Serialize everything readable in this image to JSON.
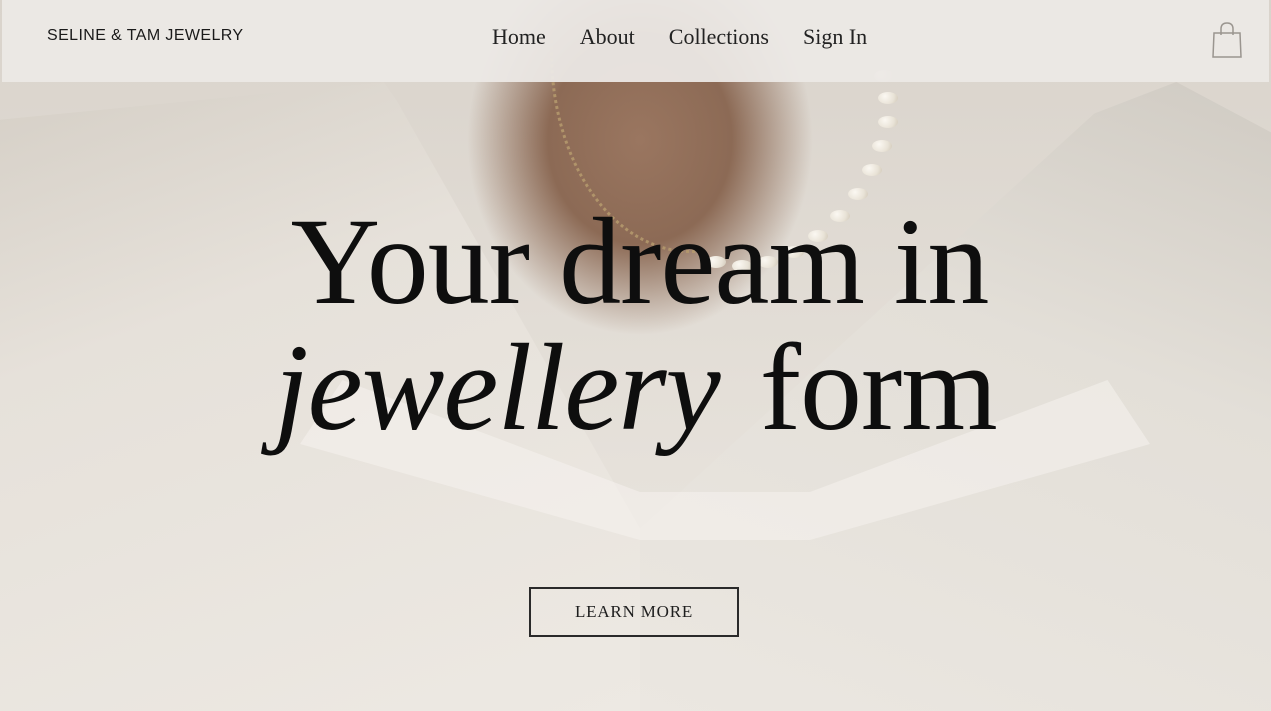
{
  "brand": "SELINE & TAM JEWELRY",
  "nav": {
    "items": [
      {
        "label": "Home"
      },
      {
        "label": "About"
      },
      {
        "label": "Collections"
      },
      {
        "label": "Sign In"
      }
    ]
  },
  "cart": {
    "icon": "shopping-bag-icon"
  },
  "hero": {
    "headline_line1": "Your dream in",
    "headline_italic": "jewellery",
    "headline_rest": "form",
    "cta_label": "LEARN MORE"
  },
  "colors": {
    "text": "#0e0e0e",
    "header_bg": "#ece9e5",
    "accent_border": "#2a2a2a"
  }
}
